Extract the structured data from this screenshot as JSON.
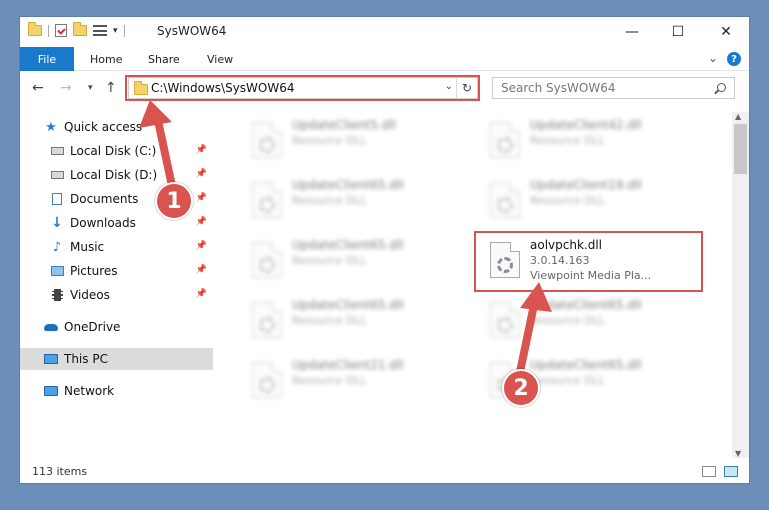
{
  "window": {
    "title": "SysWOW64"
  },
  "ribbon": {
    "tabs": [
      {
        "label": "File"
      },
      {
        "label": "Home"
      },
      {
        "label": "Share"
      },
      {
        "label": "View"
      }
    ],
    "help": "?"
  },
  "navigation": {
    "address": "C:\\Windows\\SysWOW64",
    "search_placeholder": "Search SysWOW64"
  },
  "sidebar": {
    "items": [
      {
        "label": "Quick access",
        "icon": "star-icon"
      },
      {
        "label": "Local Disk (C:)",
        "icon": "drive-icon",
        "pinned": true
      },
      {
        "label": "Local Disk (D:)",
        "icon": "drive-icon",
        "pinned": true
      },
      {
        "label": "Documents",
        "icon": "document-icon",
        "pinned": true
      },
      {
        "label": "Downloads",
        "icon": "download-icon",
        "pinned": true
      },
      {
        "label": "Music",
        "icon": "music-icon",
        "pinned": true
      },
      {
        "label": "Pictures",
        "icon": "pictures-icon",
        "pinned": true
      },
      {
        "label": "Videos",
        "icon": "video-icon",
        "pinned": true
      },
      {
        "label": "OneDrive",
        "icon": "cloud-icon"
      },
      {
        "label": "This PC",
        "icon": "computer-icon",
        "selected": true
      },
      {
        "label": "Network",
        "icon": "network-icon"
      }
    ]
  },
  "files": {
    "left": [
      {
        "name": "UpdateClient5.dll",
        "type": "Resource DLL"
      },
      {
        "name": "UpdateClient65.dll",
        "type": "Resource DLL"
      },
      {
        "name": "UpdateClient65.dll",
        "type": "Resource DLL"
      },
      {
        "name": "UpdateClient65.dll",
        "type": "Resource DLL"
      },
      {
        "name": "UpdateClient21.dll",
        "type": "Resource DLL"
      }
    ],
    "right": [
      {
        "name": "UpdateClient42.dll",
        "type": "Resource DLL"
      },
      {
        "name": "UpdateClient19.dll",
        "type": "Resource DLL"
      },
      {
        "name": "UpdateClient65.dll",
        "type": "Resource DLL"
      },
      {
        "name": "UpdateClient65.dll",
        "type": "Resource DLL"
      }
    ],
    "highlighted": {
      "name": "aolvpchk.dll",
      "version": "3.0.14.163",
      "description": "Viewpoint Media Pla..."
    }
  },
  "status": {
    "item_count": "113 items"
  },
  "annotations": {
    "badge1": "1",
    "badge2": "2",
    "color": "#d9534f"
  }
}
